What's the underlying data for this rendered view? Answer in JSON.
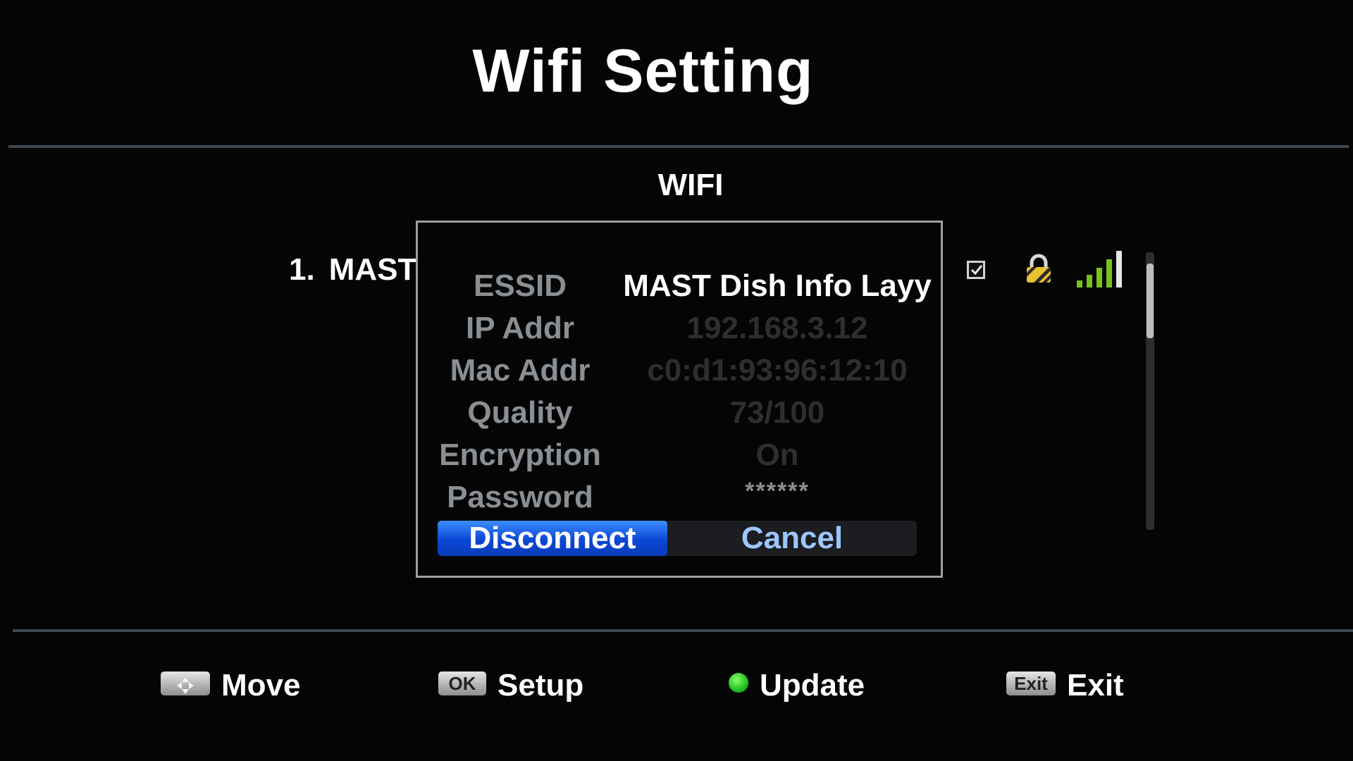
{
  "header": {
    "title": "Wifi Setting"
  },
  "section": {
    "title": "WIFI"
  },
  "network_list": {
    "items": [
      {
        "number": "1.",
        "ssid_visible": "MAST"
      }
    ],
    "selected_checked": true,
    "encrypted": true,
    "signal_bars": 4
  },
  "dialog": {
    "rows": [
      {
        "label": "ESSID",
        "value": "MAST Dish Info Layy"
      },
      {
        "label": "IP Addr",
        "value": "192.168.3.12"
      },
      {
        "label": "Mac Addr",
        "value": "c0:d1:93:96:12:10"
      },
      {
        "label": "Quality",
        "value": "73/100"
      },
      {
        "label": "Encryption",
        "value": "On"
      },
      {
        "label": "Password",
        "value": "******"
      }
    ],
    "buttons": {
      "disconnect": "Disconnect",
      "cancel": "Cancel"
    }
  },
  "footer": {
    "move": {
      "key": "",
      "label": "Move",
      "icon": "dpad-arrows-icon"
    },
    "setup": {
      "key": "OK",
      "label": "Setup"
    },
    "update": {
      "label": "Update",
      "color": "#22c322"
    },
    "exit": {
      "key": "Exit",
      "label": "Exit"
    }
  },
  "colors": {
    "background": "#050505",
    "accent_blue": "#0b47d6",
    "cancel_text": "#9cc6ff",
    "rule": "#3e4850"
  }
}
